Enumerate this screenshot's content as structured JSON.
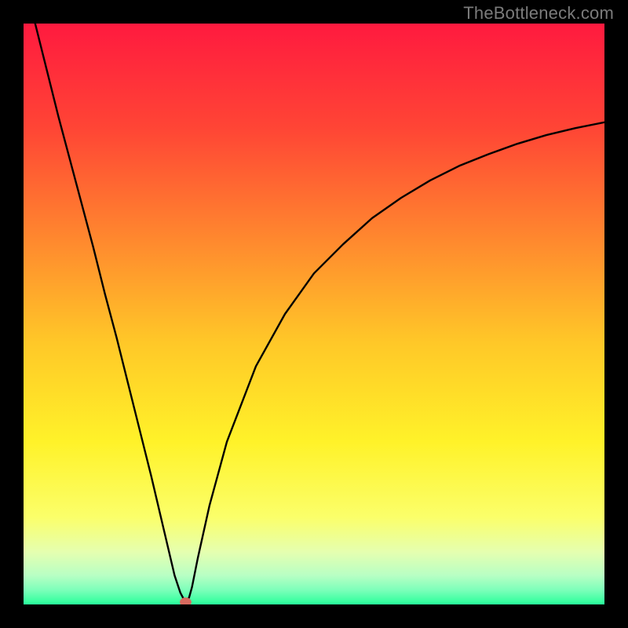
{
  "watermark": "TheBottleneck.com",
  "chart_data": {
    "type": "line",
    "title": "",
    "xlabel": "",
    "ylabel": "",
    "xlim": [
      0,
      100
    ],
    "ylim": [
      0,
      100
    ],
    "grid": false,
    "series": [
      {
        "name": "bottleneck-curve",
        "x": [
          2,
          4,
          6,
          8,
          10,
          12,
          14,
          16,
          18,
          20,
          22,
          24,
          26,
          27,
          27.8,
          28,
          28.5,
          29,
          30,
          32,
          35,
          40,
          45,
          50,
          55,
          60,
          65,
          70,
          75,
          80,
          85,
          90,
          95,
          100
        ],
        "y": [
          100,
          92,
          84,
          76.5,
          69,
          61.5,
          53.5,
          46,
          38,
          30,
          22,
          13.5,
          5,
          2,
          0.5,
          0.5,
          1.2,
          3,
          8,
          17,
          28,
          41,
          50,
          57,
          62,
          66.5,
          70,
          73,
          75.5,
          77.5,
          79.3,
          80.8,
          82,
          83
        ]
      }
    ],
    "marker": {
      "x": 27.9,
      "y": 0.4,
      "color": "#d86a5f",
      "radius_pct": 0.8
    },
    "gradient_stops": [
      {
        "offset": 0.0,
        "color": "#ff1a3f"
      },
      {
        "offset": 0.18,
        "color": "#ff4535"
      },
      {
        "offset": 0.38,
        "color": "#ff8b2e"
      },
      {
        "offset": 0.55,
        "color": "#ffc828"
      },
      {
        "offset": 0.72,
        "color": "#fff229"
      },
      {
        "offset": 0.85,
        "color": "#fbff6a"
      },
      {
        "offset": 0.91,
        "color": "#e5ffb0"
      },
      {
        "offset": 0.95,
        "color": "#b8ffc4"
      },
      {
        "offset": 0.975,
        "color": "#7dffba"
      },
      {
        "offset": 1.0,
        "color": "#28ff9a"
      }
    ]
  }
}
